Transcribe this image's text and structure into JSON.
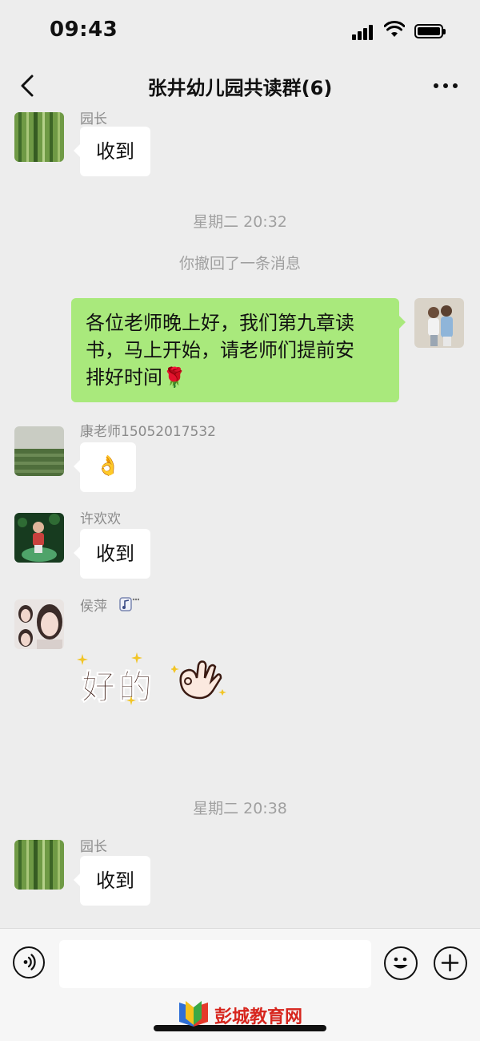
{
  "status_bar": {
    "time": "09:43"
  },
  "nav": {
    "title": "张井幼儿园共读群(6)"
  },
  "messages": {
    "m0": {
      "sender": "园长",
      "text": "收到"
    },
    "time1": "星期二 20:32",
    "recall": "你撤回了一条消息",
    "m1": {
      "text_lines": [
        "各位老师晚上好，我们第九章读",
        "书，马上开始，请老师们提前安",
        "排好时间"
      ],
      "emoji": "🌹"
    },
    "m2": {
      "sender": "康老师15052017532",
      "emoji": "👌"
    },
    "m3": {
      "sender": "许欢欢",
      "text": "收到"
    },
    "m4": {
      "sender": "侯萍",
      "sticker_text": "好的"
    },
    "time2": "星期二 20:38",
    "m5": {
      "sender": "园长",
      "text": "收到"
    }
  },
  "input": {
    "value": ""
  },
  "watermark": {
    "text": "彭城教育网"
  },
  "colors": {
    "background": "#ededed",
    "out_bubble": "#a9e97c",
    "in_bubble": "#ffffff",
    "watermark": "#d7261e"
  }
}
